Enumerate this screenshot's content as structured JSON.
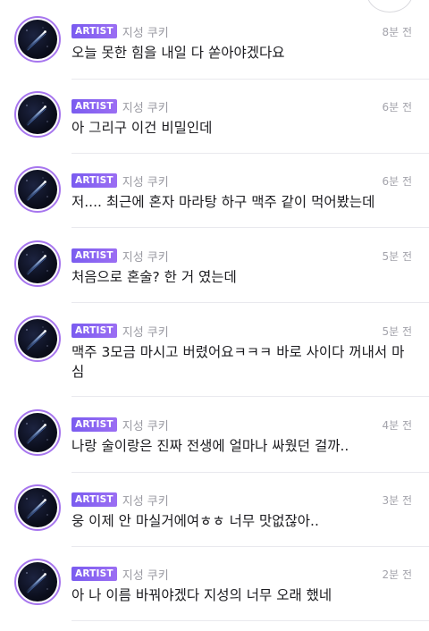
{
  "author_badge": "ARTIST",
  "author_name": "지성 쿠키",
  "messages": [
    {
      "time": "8분 전",
      "text": "오늘 못한 힘을 내일 다 쏟아야겠다요"
    },
    {
      "time": "6분 전",
      "text": "아 그리구 이건 비밀인데"
    },
    {
      "time": "6분 전",
      "text": "저.... 최근에 혼자 마라탕 하구 맥주 같이 먹어봤는데"
    },
    {
      "time": "5분 전",
      "text": "처음으로 혼술? 한 거 였는데"
    },
    {
      "time": "5분 전",
      "text": "맥주 3모금 마시고 버렸어요ㅋㅋㅋ 바로 사이다 꺼내서 마심"
    },
    {
      "time": "4분 전",
      "text": "나랑 술이랑은 진짜 전생에 얼마나 싸웠던 걸까.."
    },
    {
      "time": "3분 전",
      "text": "웅 이제 안 마실거에여ㅎㅎ 너무 맛없잖아.."
    },
    {
      "time": "2분 전",
      "text": "아 나 이름 바꿔야겠다 지성의 너무 오래 했네"
    }
  ],
  "colors": {
    "badge": "#8a63f2",
    "avatar_ring": "#a776ee",
    "text": "#1b1b1f",
    "meta": "#9a9aa2",
    "divider": "#e9e9ee"
  },
  "icons": {
    "avatar": "comet-avatar-image"
  }
}
